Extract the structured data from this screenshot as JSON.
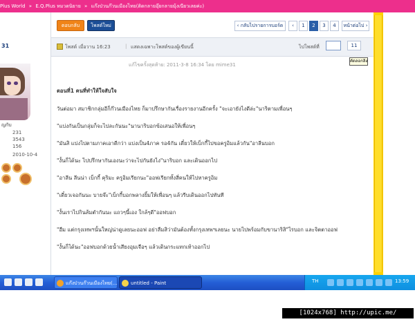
{
  "breadcrumb": [
    "Plus World",
    "»",
    "E.Q.Plus หมวดนิยาย",
    "»",
    "แก๊งป่วนก๊วนเมืองไทย(ติดกลายอุ๊ยกลายมุ้งเนียวเลยค่ะ)"
  ],
  "sidebar": {
    "username": "31",
    "rank": "ญกับ",
    "stats": [
      "231",
      "3543",
      "156",
      "2010-10-4"
    ]
  },
  "toolbar": {
    "reply_label": "ตอบกลับ",
    "newpost_label": "โพสต์ใหม่",
    "back_label": "‹ กลับไปรายการบอร์ด",
    "pages": [
      "‹",
      "1",
      "2",
      "3",
      "4"
    ],
    "active_page": "2",
    "next_label": "หน้าต่อไป ›"
  },
  "post_header": {
    "posted": "โพสต์ เมื่อวาน 16:23",
    "separator": "|",
    "only_author": "แสดงเฉพาะโพสต์ของผู้เขียนนี้",
    "jump_label": "ไปโพสต์ที่",
    "go_label": "11",
    "tooltip": "คัดลอกลิงค์"
  },
  "edited_note": "แก้ไขครั้งสุดท้าย: 2011-3-8 16:34 โดย mime31",
  "post": {
    "title": "ตอนที่1 คนที่ทำให้ใจสับใจ",
    "paragraphs": [
      "วันต่อมา สมาชิกกลุ่มอีก็ก๊วนเมืองไทย ก็มาปรึกษากันเรื่องรายงานอีกครั้ง \"จะเอายังไงดีล่ะ\"นาริตามเพื่อนๆ",
      "\"แบ่งกันเป็นกลุ่มก็จะไปละกันนะ\"นานาริบอกข้อเสนอให้เพื่อนๆ",
      "\"มันสิ แบ่งไปตามภาคเอาดีกว่า แบ่งเป็น4ภาค รอ4กัน เดี๋ยวให้เบ็กกี้ไปขอครูอิมแล้วกัน\"อาลีนบอก",
      "\"งั้นก็ได้นะ ไปปรึกษากันเองนะว่าจะไปกันยังไง\"นาริบอก และเดินออกไป",
      "\"อาลีน ลีนน่า เบ็กกี้ คุริมะ ครูอิมเรียกนะ\"ออฟเรียกทั้งสี่คนให้ไปหาครูอิม",
      "\"เดี๋ยวเจอกันนะ บายจ๊ะ\"เบ็กกี้บอกพลางยิ้มให้เพื่อนๆ แล้วรีบเดินออกไปทันที",
      "\"งั้นเราไปกินส้มตำกันนะ แถวๆนี้เอง ใกล้ๆดี\"ออฟบอก",
      "\"อืม แต่กรุงเทพฯนั้นใหญ่น่าดูเลยนะออฟ อย่าลืมสิว่ามันต้องทั้งกรุงเทพฯเลยนะ นายไปพร้อมกับขานาริสิ\"ไรบอก และจิตตาออฟ",
      "\"งั้นก็ได้นะ\"ออฟบอกด้วยน้ำเสียงอุมเจือๆ แล้วเดินกระแทกเท้าออกไป"
    ]
  },
  "taskbar": {
    "tasks": [
      "แก๊งป่วนก๊วนเมืองไทย(...",
      "untitled - Paint"
    ],
    "language": "TH",
    "clock": "13:59"
  },
  "watermark": "[1024x768] http://upic.me/",
  "colors": {
    "header_pink": "#ed2f8c",
    "scrollbar_yellow": "#ffd200",
    "reply_orange": "#f08418",
    "newpost_blue": "#1b4e96",
    "taskbar_blue": "#245ed6"
  }
}
